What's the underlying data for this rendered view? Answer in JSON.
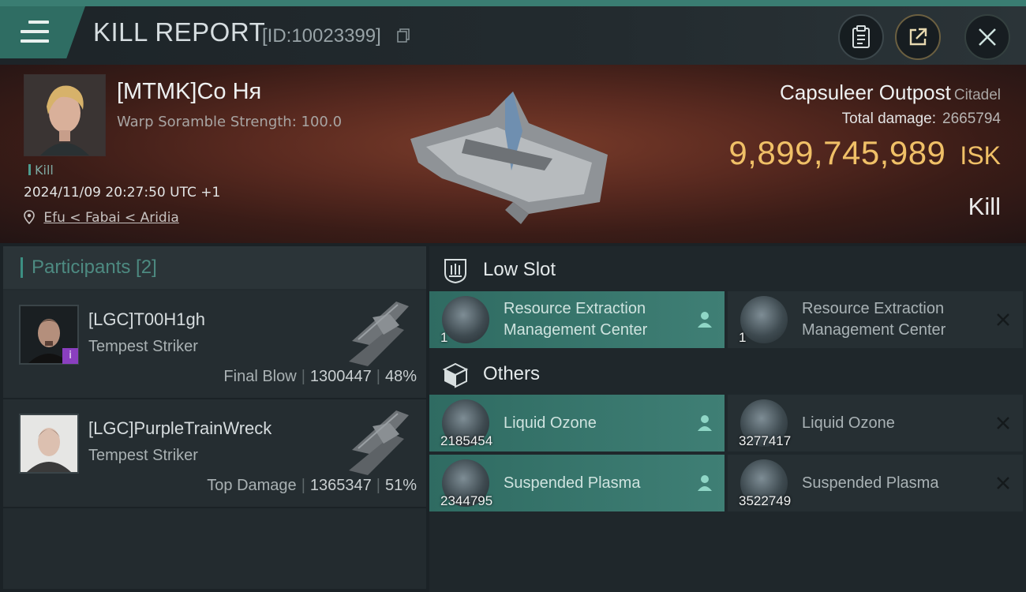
{
  "header": {
    "title": "KILL REPORT",
    "report_id": "[ID:10023399]"
  },
  "victim": {
    "name": "[MTMK]Co Ня",
    "warp_scramble": "Warp Soramble Strength: 100.0",
    "kill_tag": "Kill",
    "datetime": "2024/11/09 20:27:50 UTC +1",
    "location": "Efu < Fabai < Aridia",
    "ship_name": "Capsuleer Outpost",
    "ship_type": "Citadel",
    "total_damage_label": "Total damage:",
    "total_damage": "2665794",
    "isk_value": "9,899,745,989",
    "isk_unit": "ISK",
    "result": "Kill"
  },
  "participants": {
    "header": "Participants [2]",
    "list": [
      {
        "name": "[LGC]T00H1gh",
        "ship": "Tempest Striker",
        "role": "Final Blow",
        "damage": "1300447",
        "percent": "48%",
        "badge": "i"
      },
      {
        "name": "[LGC]PurpleTrainWreck",
        "ship": "Tempest Striker",
        "role": "Top Damage",
        "damage": "1365347",
        "percent": "51%"
      }
    ]
  },
  "sections": {
    "low_slot": "Low Slot",
    "others": "Others"
  },
  "items": {
    "low_slot": [
      {
        "name": "Resource Extraction Management Center",
        "qty": "1",
        "status": "dropped"
      },
      {
        "name": "Resource Extraction Management Center",
        "qty": "1",
        "status": "destroyed"
      }
    ],
    "others": [
      {
        "name": "Liquid Ozone",
        "qty": "2185454",
        "status": "dropped"
      },
      {
        "name": "Liquid Ozone",
        "qty": "3277417",
        "status": "destroyed"
      },
      {
        "name": "Suspended Plasma",
        "qty": "2344795",
        "status": "dropped"
      },
      {
        "name": "Suspended Plasma",
        "qty": "3522749",
        "status": "destroyed"
      }
    ]
  },
  "colors": {
    "accent": "#3c8f83",
    "isk": "#f0c067",
    "dropped": "#3f7f75"
  }
}
